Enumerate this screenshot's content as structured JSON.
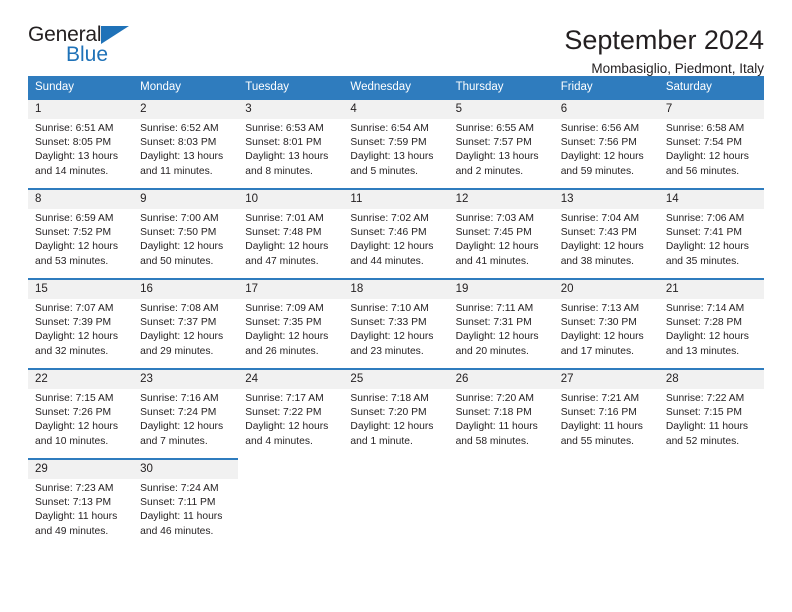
{
  "brand": {
    "name_part1": "General",
    "name_part2": "Blue",
    "triangle_icon": "triangle-icon",
    "accent_color": "#1f72b8"
  },
  "header": {
    "title": "September 2024",
    "subtitle": "Mombasiglio, Piedmont, Italy"
  },
  "calendar": {
    "header_bg": "#2f7cbe",
    "daynum_bg": "#f1f1f1",
    "columns": [
      "Sunday",
      "Monday",
      "Tuesday",
      "Wednesday",
      "Thursday",
      "Friday",
      "Saturday"
    ],
    "labels": {
      "sunrise": "Sunrise:",
      "sunset": "Sunset:",
      "daylight": "Daylight:"
    },
    "weeks": [
      [
        {
          "day": "1",
          "sunrise": "Sunrise: 6:51 AM",
          "sunset": "Sunset: 8:05 PM",
          "daylight_1": "Daylight: 13 hours",
          "daylight_2": "and 14 minutes."
        },
        {
          "day": "2",
          "sunrise": "Sunrise: 6:52 AM",
          "sunset": "Sunset: 8:03 PM",
          "daylight_1": "Daylight: 13 hours",
          "daylight_2": "and 11 minutes."
        },
        {
          "day": "3",
          "sunrise": "Sunrise: 6:53 AM",
          "sunset": "Sunset: 8:01 PM",
          "daylight_1": "Daylight: 13 hours",
          "daylight_2": "and 8 minutes."
        },
        {
          "day": "4",
          "sunrise": "Sunrise: 6:54 AM",
          "sunset": "Sunset: 7:59 PM",
          "daylight_1": "Daylight: 13 hours",
          "daylight_2": "and 5 minutes."
        },
        {
          "day": "5",
          "sunrise": "Sunrise: 6:55 AM",
          "sunset": "Sunset: 7:57 PM",
          "daylight_1": "Daylight: 13 hours",
          "daylight_2": "and 2 minutes."
        },
        {
          "day": "6",
          "sunrise": "Sunrise: 6:56 AM",
          "sunset": "Sunset: 7:56 PM",
          "daylight_1": "Daylight: 12 hours",
          "daylight_2": "and 59 minutes."
        },
        {
          "day": "7",
          "sunrise": "Sunrise: 6:58 AM",
          "sunset": "Sunset: 7:54 PM",
          "daylight_1": "Daylight: 12 hours",
          "daylight_2": "and 56 minutes."
        }
      ],
      [
        {
          "day": "8",
          "sunrise": "Sunrise: 6:59 AM",
          "sunset": "Sunset: 7:52 PM",
          "daylight_1": "Daylight: 12 hours",
          "daylight_2": "and 53 minutes."
        },
        {
          "day": "9",
          "sunrise": "Sunrise: 7:00 AM",
          "sunset": "Sunset: 7:50 PM",
          "daylight_1": "Daylight: 12 hours",
          "daylight_2": "and 50 minutes."
        },
        {
          "day": "10",
          "sunrise": "Sunrise: 7:01 AM",
          "sunset": "Sunset: 7:48 PM",
          "daylight_1": "Daylight: 12 hours",
          "daylight_2": "and 47 minutes."
        },
        {
          "day": "11",
          "sunrise": "Sunrise: 7:02 AM",
          "sunset": "Sunset: 7:46 PM",
          "daylight_1": "Daylight: 12 hours",
          "daylight_2": "and 44 minutes."
        },
        {
          "day": "12",
          "sunrise": "Sunrise: 7:03 AM",
          "sunset": "Sunset: 7:45 PM",
          "daylight_1": "Daylight: 12 hours",
          "daylight_2": "and 41 minutes."
        },
        {
          "day": "13",
          "sunrise": "Sunrise: 7:04 AM",
          "sunset": "Sunset: 7:43 PM",
          "daylight_1": "Daylight: 12 hours",
          "daylight_2": "and 38 minutes."
        },
        {
          "day": "14",
          "sunrise": "Sunrise: 7:06 AM",
          "sunset": "Sunset: 7:41 PM",
          "daylight_1": "Daylight: 12 hours",
          "daylight_2": "and 35 minutes."
        }
      ],
      [
        {
          "day": "15",
          "sunrise": "Sunrise: 7:07 AM",
          "sunset": "Sunset: 7:39 PM",
          "daylight_1": "Daylight: 12 hours",
          "daylight_2": "and 32 minutes."
        },
        {
          "day": "16",
          "sunrise": "Sunrise: 7:08 AM",
          "sunset": "Sunset: 7:37 PM",
          "daylight_1": "Daylight: 12 hours",
          "daylight_2": "and 29 minutes."
        },
        {
          "day": "17",
          "sunrise": "Sunrise: 7:09 AM",
          "sunset": "Sunset: 7:35 PM",
          "daylight_1": "Daylight: 12 hours",
          "daylight_2": "and 26 minutes."
        },
        {
          "day": "18",
          "sunrise": "Sunrise: 7:10 AM",
          "sunset": "Sunset: 7:33 PM",
          "daylight_1": "Daylight: 12 hours",
          "daylight_2": "and 23 minutes."
        },
        {
          "day": "19",
          "sunrise": "Sunrise: 7:11 AM",
          "sunset": "Sunset: 7:31 PM",
          "daylight_1": "Daylight: 12 hours",
          "daylight_2": "and 20 minutes."
        },
        {
          "day": "20",
          "sunrise": "Sunrise: 7:13 AM",
          "sunset": "Sunset: 7:30 PM",
          "daylight_1": "Daylight: 12 hours",
          "daylight_2": "and 17 minutes."
        },
        {
          "day": "21",
          "sunrise": "Sunrise: 7:14 AM",
          "sunset": "Sunset: 7:28 PM",
          "daylight_1": "Daylight: 12 hours",
          "daylight_2": "and 13 minutes."
        }
      ],
      [
        {
          "day": "22",
          "sunrise": "Sunrise: 7:15 AM",
          "sunset": "Sunset: 7:26 PM",
          "daylight_1": "Daylight: 12 hours",
          "daylight_2": "and 10 minutes."
        },
        {
          "day": "23",
          "sunrise": "Sunrise: 7:16 AM",
          "sunset": "Sunset: 7:24 PM",
          "daylight_1": "Daylight: 12 hours",
          "daylight_2": "and 7 minutes."
        },
        {
          "day": "24",
          "sunrise": "Sunrise: 7:17 AM",
          "sunset": "Sunset: 7:22 PM",
          "daylight_1": "Daylight: 12 hours",
          "daylight_2": "and 4 minutes."
        },
        {
          "day": "25",
          "sunrise": "Sunrise: 7:18 AM",
          "sunset": "Sunset: 7:20 PM",
          "daylight_1": "Daylight: 12 hours",
          "daylight_2": "and 1 minute."
        },
        {
          "day": "26",
          "sunrise": "Sunrise: 7:20 AM",
          "sunset": "Sunset: 7:18 PM",
          "daylight_1": "Daylight: 11 hours",
          "daylight_2": "and 58 minutes."
        },
        {
          "day": "27",
          "sunrise": "Sunrise: 7:21 AM",
          "sunset": "Sunset: 7:16 PM",
          "daylight_1": "Daylight: 11 hours",
          "daylight_2": "and 55 minutes."
        },
        {
          "day": "28",
          "sunrise": "Sunrise: 7:22 AM",
          "sunset": "Sunset: 7:15 PM",
          "daylight_1": "Daylight: 11 hours",
          "daylight_2": "and 52 minutes."
        }
      ],
      [
        {
          "day": "29",
          "sunrise": "Sunrise: 7:23 AM",
          "sunset": "Sunset: 7:13 PM",
          "daylight_1": "Daylight: 11 hours",
          "daylight_2": "and 49 minutes."
        },
        {
          "day": "30",
          "sunrise": "Sunrise: 7:24 AM",
          "sunset": "Sunset: 7:11 PM",
          "daylight_1": "Daylight: 11 hours",
          "daylight_2": "and 46 minutes."
        },
        null,
        null,
        null,
        null,
        null
      ]
    ]
  }
}
